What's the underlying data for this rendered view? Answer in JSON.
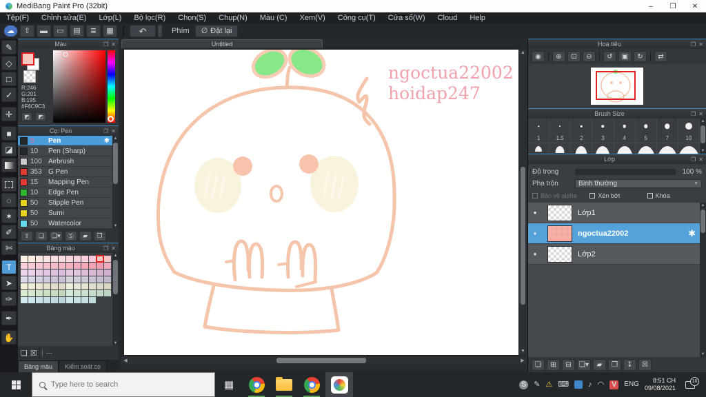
{
  "window": {
    "title": "MediBang Paint Pro (32bit)",
    "controls": [
      {
        "name": "minimize-button",
        "glyph": "–"
      },
      {
        "name": "restore-button",
        "glyph": "❐"
      },
      {
        "name": "close-button",
        "glyph": "✕"
      }
    ]
  },
  "menu": {
    "items": [
      "Tệp(F)",
      "Chỉnh sửa(E)",
      "Lớp(L)",
      "Bộ lọc(R)",
      "Chọn(S)",
      "Chụp(N)",
      "Màu (C)",
      "Xem(V)",
      "Công cụ(T)",
      "Cửa sổ(W)",
      "Cloud",
      "Help"
    ]
  },
  "toolbar": {
    "icons": [
      {
        "name": "cloud-sync-icon",
        "glyph": "☁",
        "blue": true
      },
      {
        "name": "publish-icon",
        "glyph": "⇧"
      },
      {
        "name": "comment-icon",
        "glyph": "▬"
      },
      {
        "name": "comment-panel-icon",
        "glyph": "▭"
      },
      {
        "name": "document-icon",
        "glyph": "▤"
      },
      {
        "name": "list-settings-icon",
        "glyph": "≣"
      },
      {
        "name": "window-layout-icon",
        "glyph": "▦"
      }
    ],
    "undo_glyph": "↶",
    "key_label": "Phím",
    "reset_icon": "∅",
    "reset_label": "Đặt lại"
  },
  "tools": [
    {
      "name": "tool-pen",
      "glyph": "✎"
    },
    {
      "name": "tool-eraser",
      "glyph": "◇"
    },
    {
      "name": "tool-shape",
      "glyph": "□"
    },
    {
      "name": "tool-control-pen",
      "glyph": "✓"
    },
    {
      "name": "tool-move",
      "glyph": "✛",
      "gap": true
    },
    {
      "name": "tool-select",
      "glyph": "■",
      "gap": true
    },
    {
      "name": "tool-bucket",
      "glyph": "◪"
    },
    {
      "name": "tool-gradient",
      "type": "gradient"
    },
    {
      "name": "tool-marquee",
      "type": "dashed",
      "gap": true
    },
    {
      "name": "tool-lasso",
      "glyph": "◌"
    },
    {
      "name": "tool-magic-wand",
      "glyph": "✶"
    },
    {
      "name": "tool-select-pen",
      "glyph": "✐"
    },
    {
      "name": "tool-select-eraser",
      "glyph": "✄"
    },
    {
      "name": "tool-text",
      "glyph": "T",
      "active": true,
      "gap": true
    },
    {
      "name": "tool-operate",
      "glyph": "➤"
    },
    {
      "name": "tool-divide",
      "glyph": "✑"
    },
    {
      "name": "tool-eyedropper",
      "glyph": "✒",
      "gap": true
    },
    {
      "name": "tool-hand",
      "glyph": "✋",
      "gap": true
    }
  ],
  "color_panel": {
    "title": "Màu",
    "r": "R:246",
    "g": "G:201",
    "b": "B:195",
    "hex": "#F6C9C3",
    "foreground": "#F6C9C3",
    "background": "#FFFFFF"
  },
  "brush_panel": {
    "title": "Cọ: Pen",
    "brushes": [
      {
        "size": "5",
        "name": "Pen",
        "swatch": "#26292c",
        "selected": true
      },
      {
        "size": "10",
        "name": "Pen (Sharp)",
        "swatch": "#26292c"
      },
      {
        "size": "100",
        "name": "Airbrush",
        "swatch": "#c9c9c9"
      },
      {
        "size": "353",
        "name": "G Pen",
        "swatch": "#e23b34"
      },
      {
        "size": "15",
        "name": "Mapping Pen",
        "swatch": "#e23b34"
      },
      {
        "size": "10",
        "name": "Edge Pen",
        "swatch": "#2eb82e"
      },
      {
        "size": "50",
        "name": "Stipple Pen",
        "swatch": "#e8d21f"
      },
      {
        "size": "50",
        "name": "Sumi",
        "swatch": "#e8d21f"
      },
      {
        "size": "50",
        "name": "Watercolor",
        "swatch": "#63d7ee"
      }
    ],
    "gear_glyph": "✱",
    "buttons": [
      {
        "name": "upload-brush-button",
        "glyph": "⇪"
      },
      {
        "name": "add-brush-button",
        "glyph": "❏"
      },
      {
        "name": "add-brush-menu-button",
        "glyph": "❏▾"
      },
      {
        "name": "add-script-brush-button",
        "glyph": "Ⓢ"
      },
      {
        "name": "brush-folder-button",
        "glyph": "▰"
      },
      {
        "name": "duplicate-brush-button",
        "glyph": "❐"
      }
    ]
  },
  "palette_panel": {
    "title": "Bảng màu",
    "selected": {
      "row": 0,
      "col": 10
    },
    "rows": [
      [
        "#fdf2e4",
        "#fdeede",
        "#fce9e0",
        "#fbe4e0",
        "#fbdfdf",
        "#fadbdf",
        "#f9d6de",
        "#f8d2dd",
        "#f8cddc",
        "#f7c9db",
        "#f6c9c3",
        "#f5c4c6"
      ],
      [
        "#f9d0d8",
        "#f8cbd4",
        "#f7c6d0",
        "#f6c1cc",
        "#f5bcc8",
        "#f5b7c4",
        "#f4b2c0",
        "#f3adbc",
        "#f2a9b8",
        "#f1a4b4",
        "#f09fb0",
        "#f1a9bc"
      ],
      [
        "#ecd6ec",
        "#e8d1e8",
        "#e5cce5",
        "#e1c7e1",
        "#ddc2dd",
        "#dabdda",
        "#e4c8e0",
        "#e0c3dc",
        "#ddbed8",
        "#d9b9d4",
        "#d5b4d0",
        "#d2afcc"
      ],
      [
        "#dcd8e8",
        "#d8d3e4",
        "#d5cee1",
        "#d1c9dd",
        "#cdc4d9",
        "#cabfd6",
        "#d6d2dc",
        "#d2cdd8",
        "#cfc8d5",
        "#cbc3d1",
        "#c7becd",
        "#c4b9ca"
      ],
      [
        "#f2f0da",
        "#eeebd5",
        "#ebe7d1",
        "#e7e2cc",
        "#e3dec8",
        "#e0d9c3",
        "#eaeeda",
        "#e6e9d5",
        "#e3e5d1",
        "#dfe0cc",
        "#dbdcc8",
        "#d8d7c3"
      ],
      [
        "#daecd2",
        "#d5e8cd",
        "#d1e4c9",
        "#cce0c4",
        "#c8dcc0",
        "#c3d8bb",
        "#d4ead8",
        "#cfe6d3",
        "#cbe2cf",
        "#c6deca",
        "#c2dac6",
        "#bdd6c1"
      ],
      [
        "#d4eaee",
        "#cfe6ea",
        "#cbe2e6",
        "#c6dee2",
        "#c2dade",
        "#bdd6da",
        "#cee8e8",
        "#c9e4e4",
        "#c5e0e0",
        "#c0dcdc"
      ]
    ],
    "buttons": [
      {
        "name": "add-color-button",
        "glyph": "❏"
      },
      {
        "name": "delete-color-button",
        "glyph": "☒"
      }
    ],
    "footer_text": "---"
  },
  "left_tabs": {
    "palette": "Bảng màu",
    "brush_control": "Kiểm soát cọ"
  },
  "canvas": {
    "tab": "Untitled",
    "watermark_line1": "ngoctua22002",
    "watermark_line2": "hoidap247",
    "outline_color": "#f5c5ab",
    "leaf_color": "#87e887",
    "cheek_color": "#f9f3dd",
    "eye_color": "#f8c3ac",
    "watermark_color": "#f2a2ac"
  },
  "navigator": {
    "title": "Hoa tiêu",
    "buttons": [
      {
        "name": "zoom-actual-button",
        "glyph": "◉",
        "sep": true
      },
      {
        "name": "zoom-in-button",
        "glyph": "⊕"
      },
      {
        "name": "fit-screen-button",
        "glyph": "⊡"
      },
      {
        "name": "zoom-out-button",
        "glyph": "⊖",
        "sep": true
      },
      {
        "name": "rotate-left-button",
        "glyph": "↺"
      },
      {
        "name": "reset-rotation-button",
        "glyph": "▣"
      },
      {
        "name": "rotate-right-button",
        "glyph": "↻",
        "sep": true
      },
      {
        "name": "flip-view-button",
        "glyph": "⇄"
      }
    ]
  },
  "brush_size": {
    "title": "Brush Size",
    "sizes": [
      "1",
      "1.5",
      "2",
      "3",
      "4",
      "5",
      "7",
      "10"
    ],
    "dots": [
      1.5,
      2,
      2.5,
      3.5,
      4.5,
      5.5,
      7.5,
      10
    ],
    "row2_widths": [
      10,
      13,
      17,
      21,
      24,
      27,
      30,
      33
    ]
  },
  "layers": {
    "title": "Lớp",
    "opacity_label": "Độ trong",
    "opacity_value": "100 %",
    "blend_label": "Pha trộn",
    "blend_value": "Bình thường",
    "check_alpha": "Bảo vệ alpha",
    "check_clip": "Xén bớt",
    "check_lock": "Khóa",
    "items": [
      {
        "name": "Lớp1"
      },
      {
        "name": "ngoctua22002",
        "selected": true,
        "art": true
      },
      {
        "name": "Lớp2"
      }
    ],
    "gear_glyph": "✱",
    "buttons": [
      {
        "name": "add-layer-button",
        "glyph": "❏"
      },
      {
        "name": "add-8bit-layer-button",
        "glyph": "⊞"
      },
      {
        "name": "add-1bit-layer-button",
        "glyph": "⊟"
      },
      {
        "name": "add-layer-menu-button",
        "glyph": "❏▾"
      },
      {
        "name": "add-layer-folder-button",
        "glyph": "▰"
      },
      {
        "name": "duplicate-layer-button",
        "glyph": "❐"
      },
      {
        "name": "merge-layer-button",
        "glyph": "↧"
      },
      {
        "name": "delete-layer-button",
        "glyph": "☒"
      }
    ]
  },
  "taskbar": {
    "search_placeholder": "Type here to search",
    "language": "ENG",
    "time": "8:51 CH",
    "date": "09/08/2021",
    "notification_count": "16"
  },
  "colors": {
    "accent_blue": "#4f9bd5",
    "selection_red": "#e02020",
    "panel_bg": "#33363a"
  }
}
